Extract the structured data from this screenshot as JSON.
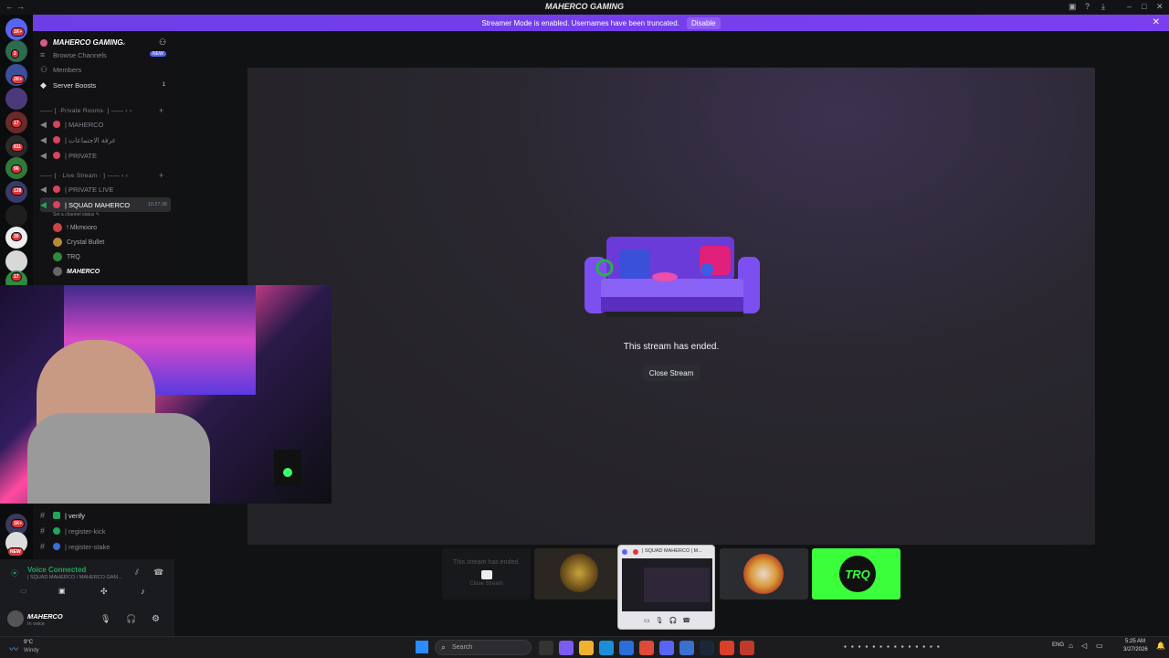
{
  "window": {
    "title": "MAHERCO GAMING",
    "controls": [
      "–",
      "□",
      "✕"
    ]
  },
  "banner": {
    "text": "Streamer Mode is enabled. Usernames have been truncated.",
    "disable_label": "Disable",
    "close": "✕"
  },
  "guilds": {
    "badges": [
      "1K+",
      "2",
      "2K+",
      "17",
      "811",
      "96",
      "128",
      "30",
      "17",
      "1K+",
      "NEW"
    ]
  },
  "sidebar": {
    "server_name": "MAHERCO GAMING",
    "top_items": [
      {
        "label": "Browse Channels"
      },
      {
        "label": "Members"
      },
      {
        "label": "Server Boosts",
        "count": "1"
      }
    ],
    "categories": [
      {
        "label": "—— [ ·Private Rooms· ] —— ‹ ‹",
        "channels": [
          "| MAHERCO",
          "| غرفة الاجتماعات",
          "| PRIVATE"
        ]
      },
      {
        "label": "—— [ · Live Stream · ] —— ‹ ‹",
        "channels": [
          "| PRIVATE LIVE",
          "| SQUAD MAHERCO"
        ]
      }
    ],
    "active_channel": {
      "label": "| SQUAD MAHERCO",
      "time": "10:27:38",
      "status": "Set a channel status ✎"
    },
    "voice_users": [
      "! Mkmooro",
      "Crystal Bullet",
      "TRQ",
      "MAHERCO"
    ],
    "bottom_channels": [
      "| verify",
      "| register-kick",
      "| register-stake"
    ]
  },
  "voice": {
    "status": "Voice Connected",
    "channel": "| SQUAD MAHERCO / MAHERCO GAM...",
    "user": "MAHERCO",
    "user_status": "In voice"
  },
  "stage": {
    "message": "This stream has ended.",
    "close_label": "Close Stream"
  },
  "tiles": {
    "ended_text": "This stream has ended.",
    "ended_close": "Close Stream",
    "trq_text": "TRQ"
  },
  "preview": {
    "title": "| SQUAD MAHERCO | M..."
  },
  "taskbar": {
    "weather_temp": "9°C",
    "weather_desc": "Windy",
    "search_placeholder": "Search",
    "lang": "ENG",
    "time": "5:25 AM",
    "date": "3/27/2026"
  },
  "colors": {
    "accent": "#7b3ff0",
    "green": "#23a55a",
    "trq_green": "#3cff3c"
  }
}
